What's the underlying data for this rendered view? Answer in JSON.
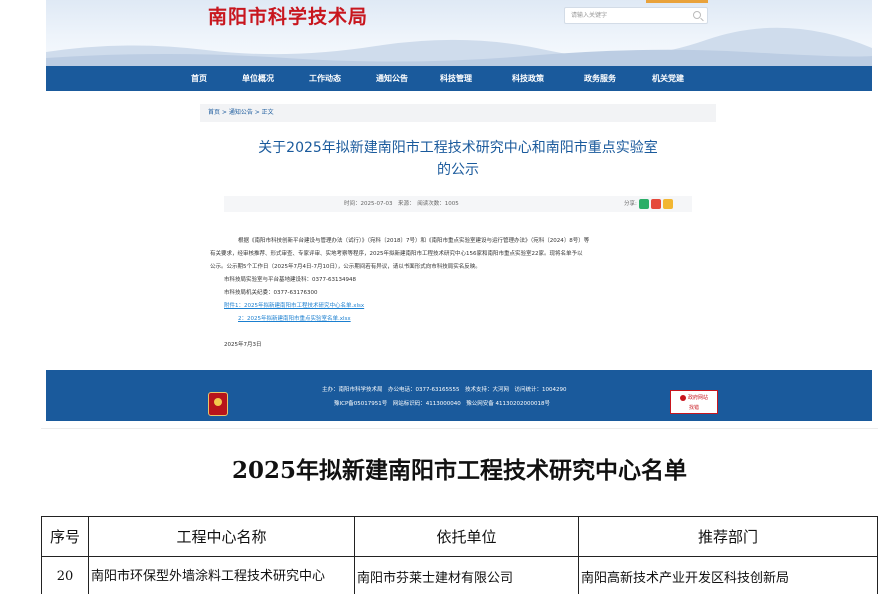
{
  "site": {
    "title": "南阳市科学技术局",
    "search_placeholder": "请输入关键字",
    "nav": [
      "首页",
      "单位概况",
      "工作动态",
      "通知公告",
      "科技管理",
      "科技政策",
      "政务服务",
      "机关党建"
    ],
    "breadcrumb": "首页 > 通知公告 > 正文",
    "article_title_line1": "关于2025年拟新建南阳市工程技术研究中心和南阳市重点实验室",
    "article_title_line2": "的公示",
    "meta_info": "时间：2025-07-03　来源：　阅读次数：1005",
    "share_label": "分享:",
    "share_colors": [
      "#2aae67",
      "#e5493a",
      "#f2b632"
    ],
    "body": [
      "根据《南阳市科技创新平台建设与管理办法（试行）》（宛科〔2018〕7号）和《南阳市重点实验室建设与运行管理办法》（宛科〔2024〕8号）等",
      "有关要求，经审核推荐、形式审查、专家评审、实地考察等程序，2025年拟新建南阳市工程技术研究中心156家和南阳市重点实验室22家。现将名单予以",
      "公示。公示期5个工作日（2025年7月4日-7月10日），公示期间若有异议，请以书面形式向市科技局实名反映。"
    ],
    "contact1": "市科技局实验室与平台基地建设科：0377-63134948",
    "contact2": "市科技局机关纪委：0377-63176300",
    "attachment1": "附件1：2025年拟新建南阳市工程技术研究中心名单.xlsx",
    "attachment2": "2：2025年拟新建南阳市重点实验室名单.xlsx",
    "date": "2025年7月3日",
    "footer_line1": "主办：南阳市科学技术局　办公电话：0377-63165555　技术支持：大河网　访问统计：1004290",
    "footer_line2": "豫ICP备05017951号　网站标识码：4113000040　豫公网安备 41130202000018号",
    "gov_badge_line1": "政府网站",
    "gov_badge_line2": "找错",
    "colors": {
      "brand_red": "#c8161e",
      "nav_blue": "#1a5a9c",
      "link_blue": "#1a7fd0"
    }
  },
  "document": {
    "title": "2025年拟新建南阳市工程技术研究中心名单",
    "columns": [
      "序号",
      "工程中心名称",
      "依托单位",
      "推荐部门"
    ],
    "rows": [
      {
        "no": "20",
        "name": "南阳市环保型外墙涂料工程技术研究中心",
        "org": "南阳市芬莱士建材有限公司",
        "dept": "南阳高新技术产业开发区科技创新局"
      }
    ]
  }
}
